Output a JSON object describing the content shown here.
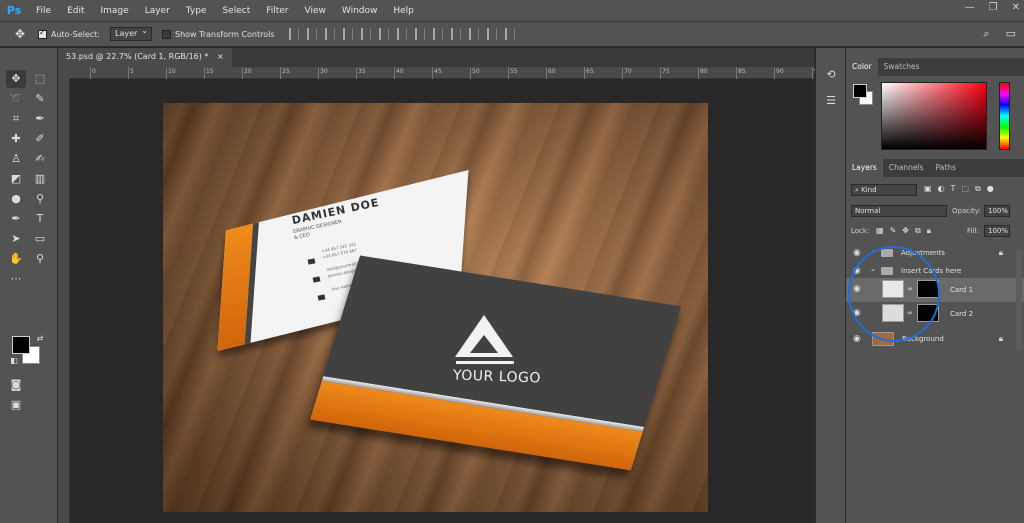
{
  "app": {
    "logo": "Ps"
  },
  "menu": [
    "File",
    "Edit",
    "Image",
    "Layer",
    "Type",
    "Select",
    "Filter",
    "View",
    "Window",
    "Help"
  ],
  "window_controls": {
    "minimize": "—",
    "restore": "❐",
    "close": "✕"
  },
  "options": {
    "auto_select_label": "Auto-Select:",
    "auto_select_target": "Layer",
    "show_transform_label": "Show Transform Controls"
  },
  "document": {
    "tab_title": "53.psd @ 22.7% (Card 1, RGB/16) *",
    "close_glyph": "×"
  },
  "ruler": {
    "numbers": [
      "0",
      "5",
      "10",
      "15",
      "20",
      "25",
      "30",
      "35",
      "40",
      "45",
      "50",
      "55",
      "60",
      "65",
      "70",
      "75",
      "80",
      "85",
      "90",
      "95"
    ]
  },
  "canvas": {
    "card_name": "DAMIEN DOE",
    "card_role_1": "GRAPHIC DESIGNER",
    "card_role_2": "& CEO",
    "card_phone_1": "+34 957 345 343",
    "card_phone_2": "+34 657 576 867",
    "card_email_1": "mail@yourmail.com",
    "card_email_2": "damien.doe@mail.com",
    "card_address": "Your Address Here",
    "logo_text": "YOUR LOGO"
  },
  "color_panel": {
    "tabs": [
      "Color",
      "Swatches"
    ],
    "foreground": "#000000",
    "background": "#ffffff"
  },
  "layers_panel": {
    "tabs": [
      "Layers",
      "Channels",
      "Paths"
    ],
    "filter": "Kind",
    "blend_mode": "Normal",
    "opacity_label": "Opacity:",
    "opacity_value": "100%",
    "lock_label": "Lock:",
    "fill_label": "Fill:",
    "fill_value": "100%",
    "layers": [
      {
        "name": "Adjustments",
        "type": "group",
        "visible": true,
        "locked": true
      },
      {
        "name": "Insert Cards here",
        "type": "group",
        "visible": true,
        "expanded": true
      },
      {
        "name": "Card 1",
        "type": "smart-masked",
        "visible": true,
        "selected": true
      },
      {
        "name": "Card 2",
        "type": "smart-masked",
        "visible": true
      },
      {
        "name": "Background",
        "type": "image",
        "visible": true,
        "locked": true
      }
    ]
  }
}
